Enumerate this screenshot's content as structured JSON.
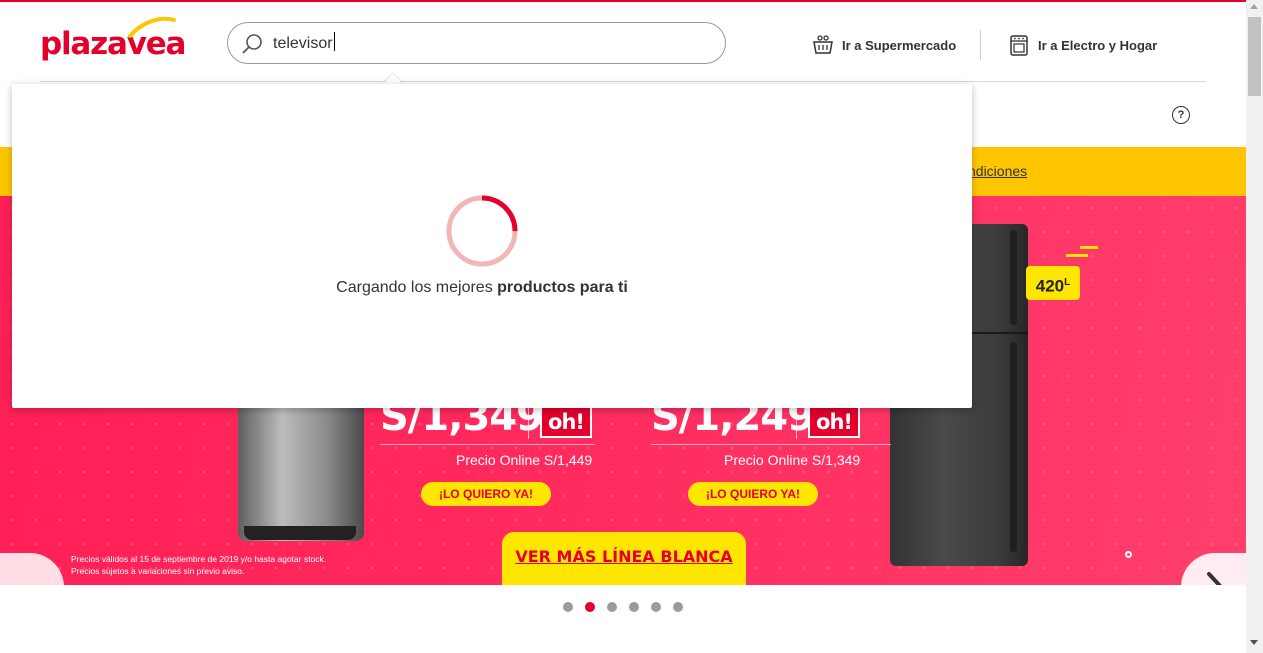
{
  "header": {
    "logo_text": "plazavea",
    "search": {
      "value": "televisor",
      "placeholder": ""
    },
    "links": [
      {
        "label": "Ir a Supermercado",
        "icon": "basket-icon"
      },
      {
        "label": "Ir a Electro y Hogar",
        "icon": "stove-icon"
      }
    ],
    "help_label": "?"
  },
  "promo_bar": {
    "link_text": "ndiciones"
  },
  "hero": {
    "capacity_badge": "420",
    "capacity_unit": "L",
    "products": [
      {
        "price": "S/1,349",
        "online_price": "Precio Online S/1,449",
        "cta": "¡LO QUIERO YA!",
        "badge": "oh!"
      },
      {
        "price": "S/1,249",
        "online_price": "Precio Online S/1,349",
        "cta": "¡LO QUIERO YA!",
        "badge": "oh!"
      }
    ],
    "disclaimer_line1": "Precios válidos al 15 de septiembre de 2019 y/o hasta agotar stock.",
    "disclaimer_line2": "Precios sujetos a variaciones sin previo aviso.",
    "ver_mas": "VER MÁS LÍNEA BLANCA"
  },
  "carousel": {
    "dot_count": 6,
    "active_index": 1
  },
  "loading": {
    "text_normal": "Cargando los mejores ",
    "text_bold": "productos para ti",
    "progress_fraction": 0.25
  },
  "colors": {
    "brand_red": "#e4002b",
    "promo_yellow": "#ffc600",
    "hero_pink": "#ff2a5e"
  }
}
